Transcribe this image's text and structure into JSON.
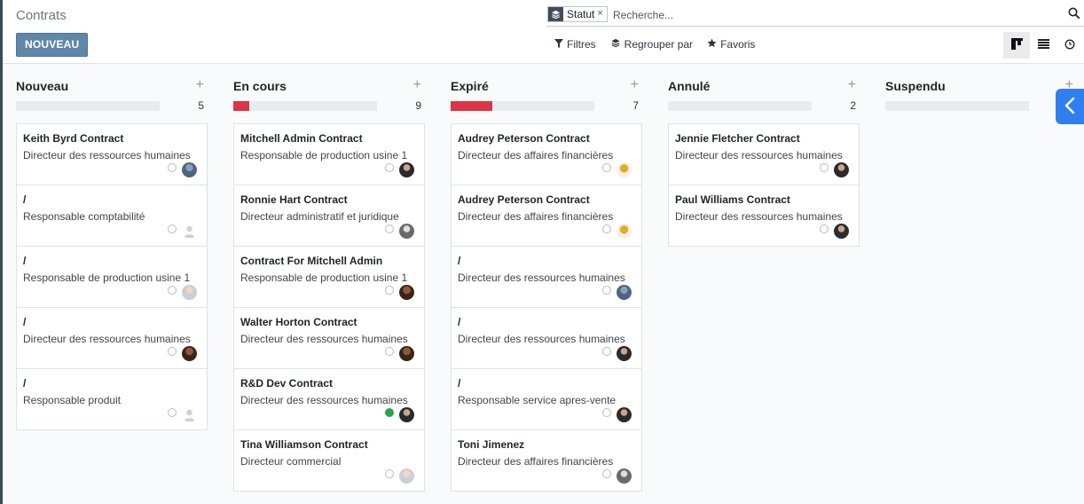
{
  "breadcrumb": "Contrats",
  "new_button": "NOUVEAU",
  "search": {
    "facet_label": "Statut",
    "facet_icon": "layers-icon",
    "placeholder": "Recherche..."
  },
  "filters": {
    "filters_label": "Filtres",
    "group_label": "Regrouper par",
    "favorites_label": "Favoris"
  },
  "colors": {
    "primary": "#5f87a8",
    "danger": "#dc3545",
    "success": "#28a745",
    "side_toggle": "#2f7ff1"
  },
  "columns": [
    {
      "title": "Nouveau",
      "count": "5",
      "progress_red": 0,
      "cards": [
        {
          "title": "Keith Byrd Contract",
          "job": "Directeur des ressources humaines",
          "state": "normal",
          "avatar": "photo-blue"
        },
        {
          "title": "/",
          "job": "Responsable comptabilité",
          "state": "normal",
          "avatar": "placeholder"
        },
        {
          "title": "/",
          "job": "Responsable de production usine 1",
          "state": "normal",
          "avatar": "photo-light"
        },
        {
          "title": "/",
          "job": "Directeur des ressources humaines",
          "state": "normal",
          "avatar": "photo-brown"
        },
        {
          "title": "/",
          "job": "Responsable produit",
          "state": "normal",
          "avatar": "placeholder"
        }
      ]
    },
    {
      "title": "En cours",
      "count": "9",
      "progress_red": 0.11,
      "cards": [
        {
          "title": "Mitchell Admin Contract",
          "job": "Responsable de production usine 1",
          "state": "normal",
          "avatar": "photo-dark"
        },
        {
          "title": "Ronnie Hart Contract",
          "job": "Directeur administratif et juridique",
          "state": "normal",
          "avatar": "photo-gray"
        },
        {
          "title": "Contract For Mitchell Admin",
          "job": "Responsable de production usine 1",
          "state": "normal",
          "avatar": "photo-brown"
        },
        {
          "title": "Walter Horton Contract",
          "job": "Directeur des ressources humaines",
          "state": "normal",
          "avatar": "photo-brown"
        },
        {
          "title": "R&D Dev Contract",
          "job": "Directeur des ressources humaines",
          "state": "done",
          "avatar": "photo-dark"
        },
        {
          "title": "Tina Williamson Contract",
          "job": "Directeur commercial",
          "state": "normal",
          "avatar": "photo-light"
        }
      ]
    },
    {
      "title": "Expiré",
      "count": "7",
      "progress_red": 0.29,
      "cards": [
        {
          "title": "Audrey Peterson Contract",
          "job": "Directeur des affaires financières",
          "state": "normal",
          "avatar": "photo-yellow"
        },
        {
          "title": "Audrey Peterson Contract",
          "job": "Directeur des affaires financières",
          "state": "normal",
          "avatar": "photo-yellow"
        },
        {
          "title": "/",
          "job": "Directeur des ressources humaines",
          "state": "normal",
          "avatar": "photo-blue"
        },
        {
          "title": "/",
          "job": "Directeur des ressources humaines",
          "state": "normal",
          "avatar": "photo-dark"
        },
        {
          "title": "/",
          "job": "Responsable service apres-vente",
          "state": "normal",
          "avatar": "photo-dark"
        },
        {
          "title": "Toni Jimenez",
          "job": "Directeur des affaires financières",
          "state": "normal",
          "avatar": "photo-gray"
        }
      ]
    },
    {
      "title": "Annulé",
      "count": "2",
      "progress_red": 0,
      "cards": [
        {
          "title": "Jennie Fletcher Contract",
          "job": "Directeur des ressources humaines",
          "state": "normal",
          "avatar": "photo-dark"
        },
        {
          "title": "Paul Williams Contract",
          "job": "Directeur des ressources humaines",
          "state": "normal",
          "avatar": "photo-dark"
        }
      ]
    },
    {
      "title": "Suspendu",
      "count": "",
      "progress_red": 0,
      "cards": []
    }
  ]
}
